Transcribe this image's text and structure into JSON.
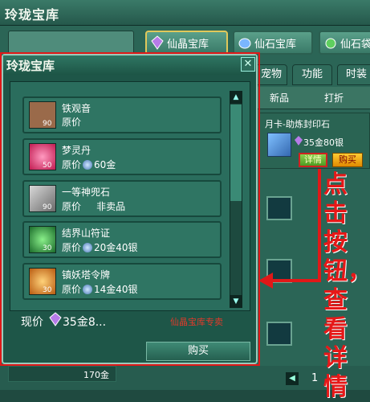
{
  "background_window": {
    "title": "玲珑宝库",
    "top_tabs": [
      {
        "label": "仙晶宝库",
        "active": true
      },
      {
        "label": "仙石宝库",
        "active": false
      },
      {
        "label": "仙石袋",
        "active": false
      }
    ],
    "sub_tabs": [
      "宠物",
      "功能",
      "时装"
    ],
    "filters": [
      "新品",
      "打折"
    ],
    "item": {
      "name": "月卡-助炼封印石",
      "price": "35金80银",
      "detail_label": "详情",
      "buy_label": "购买"
    },
    "bottom_item_price": "170金",
    "page_prev": "◀",
    "page_number": "1"
  },
  "annotation": {
    "text": "点击按钮，查看详情",
    "color": "#e01818"
  },
  "popup": {
    "title": "玲珑宝库",
    "close_label": "✕",
    "items": [
      {
        "name": "铁观音",
        "price_label": "原价",
        "price": "",
        "level": "90",
        "icon": "teacup-icon",
        "color": "#9a6a4a"
      },
      {
        "name": "梦灵丹",
        "price_label": "原价",
        "price": "60金",
        "level": "50",
        "icon": "pill-icon",
        "color": "#e03a6a"
      },
      {
        "name": "一等神兜石",
        "price_label": "原价",
        "price": "非卖品",
        "level": "90",
        "icon": "stone-icon",
        "color": "#a0a0a0"
      },
      {
        "name": "结界山符证",
        "price_label": "原价",
        "price": "20金40银",
        "level": "30",
        "icon": "jade-ring-icon",
        "color": "#2aa34a"
      },
      {
        "name": "镇妖塔令牌",
        "price_label": "原价",
        "price": "14金40银",
        "level": "30",
        "icon": "token-icon",
        "color": "#e07a2a"
      }
    ],
    "current_price_label": "现价",
    "current_price": "35金8...",
    "exclusive_note": "仙晶宝库专卖",
    "buy_label": "购买",
    "scroll_up": "▲",
    "scroll_down": "▼"
  }
}
